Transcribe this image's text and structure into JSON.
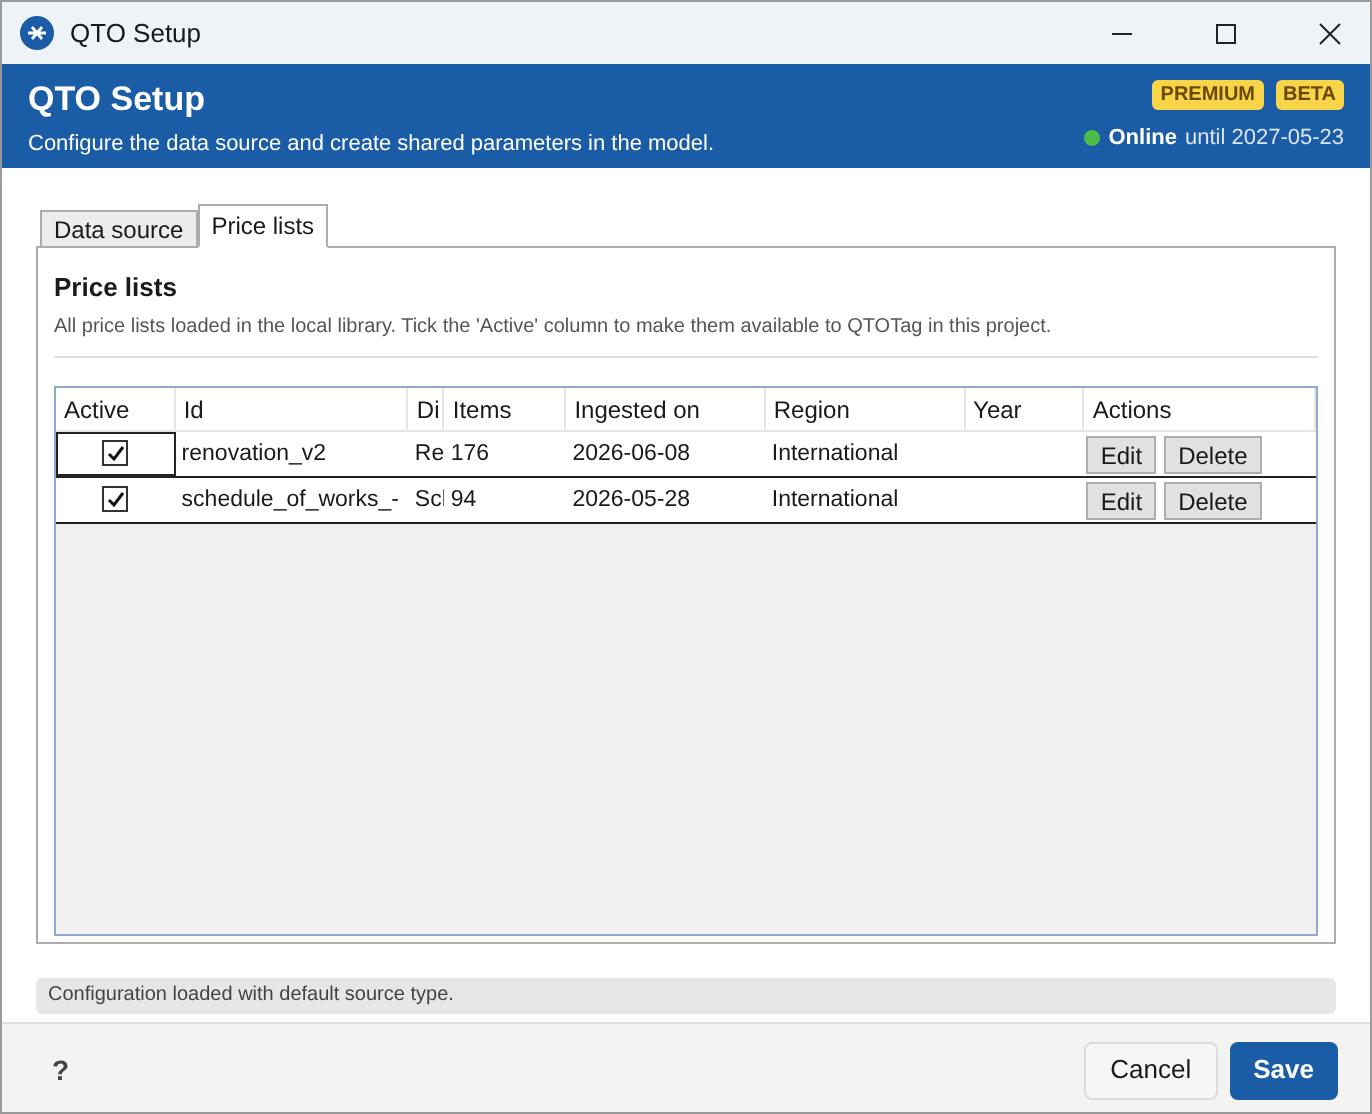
{
  "window": {
    "title": "QTO Setup"
  },
  "header": {
    "title": "QTO Setup",
    "subtitle": "Configure the data source and create shared parameters in the model.",
    "badges": [
      "PREMIUM",
      "BETA"
    ],
    "status": "Online",
    "status_detail": "until 2027-05-23",
    "online": true
  },
  "tabs": [
    {
      "label": "Data source",
      "selected": false
    },
    {
      "label": "Price lists",
      "selected": true
    }
  ],
  "section": {
    "title": "Price lists",
    "description": "All price lists loaded in the local library. Tick the 'Active' column to make them available to QTOTag in this project."
  },
  "table": {
    "columns": [
      "Active",
      "Id",
      "Di",
      "Items",
      "Ingested on",
      "Region",
      "Year",
      "Actions"
    ],
    "rows": [
      {
        "active": true,
        "focused": true,
        "id": "renovation_v2",
        "column_3": "Re",
        "items": "176",
        "ingested_on": "2026-06-08",
        "region": "International",
        "year": "",
        "actions": [
          "Edit",
          "Delete"
        ]
      },
      {
        "active": true,
        "focused": false,
        "id": "schedule_of_works_-",
        "column_3": "Scl",
        "items": "94",
        "ingested_on": "2026-05-28",
        "region": "International",
        "year": "",
        "actions": [
          "Edit",
          "Delete"
        ]
      }
    ]
  },
  "status_bar": "Configuration loaded with default source type.",
  "footer": {
    "help": "?",
    "buttons": [
      "Cancel",
      "Save"
    ]
  }
}
